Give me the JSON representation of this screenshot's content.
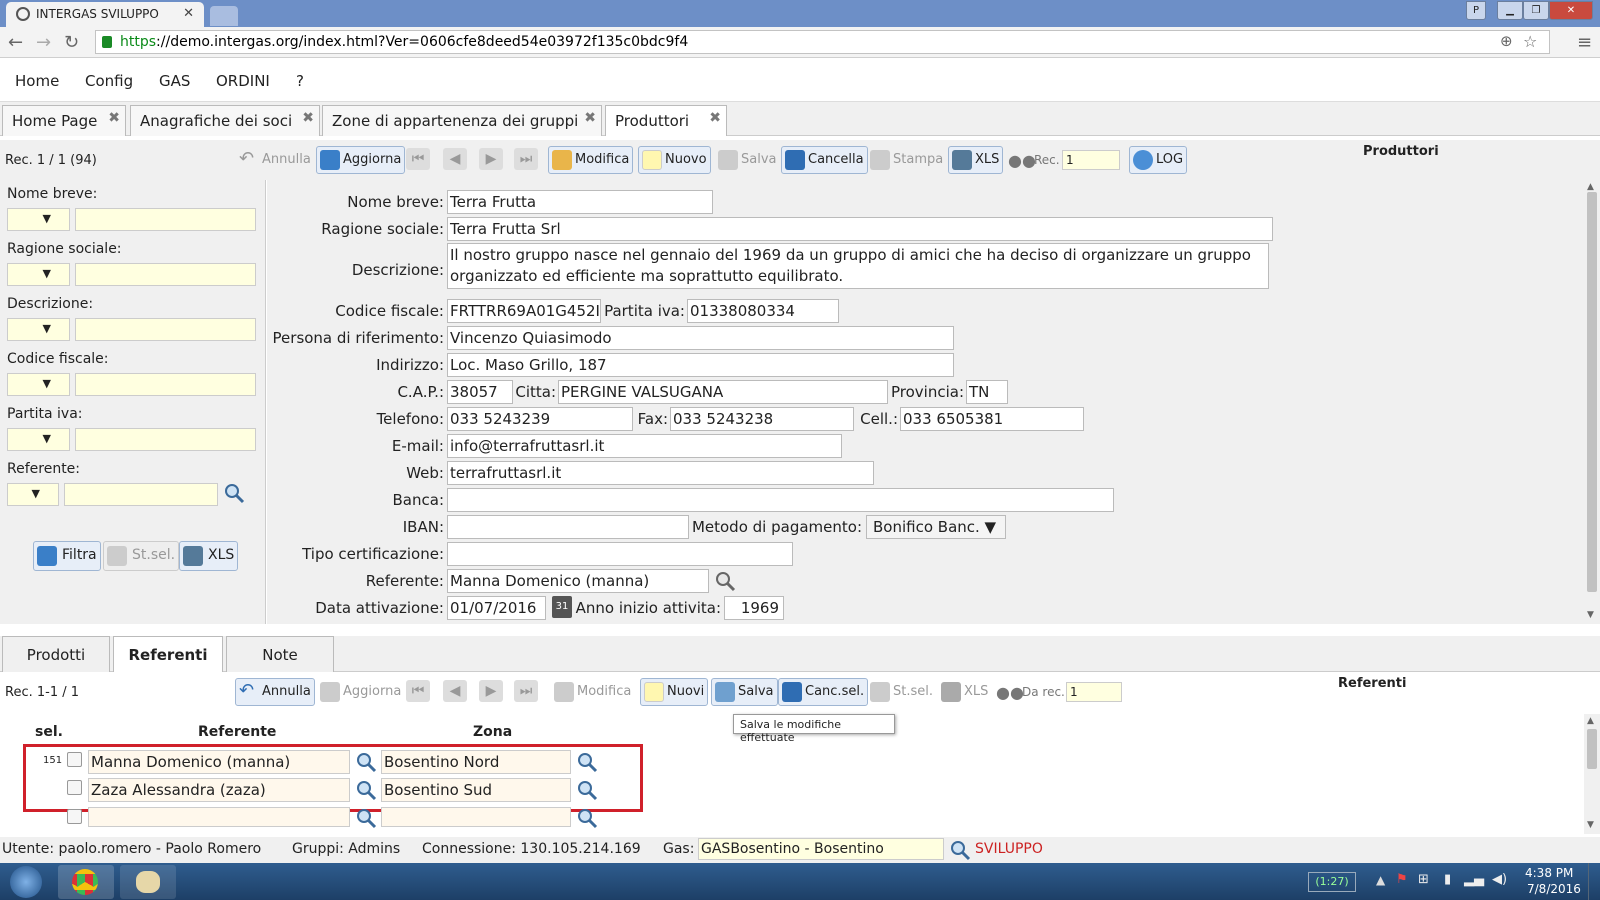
{
  "browser": {
    "tab_title": "INTERGAS SVILUPPO",
    "url_scheme": "https",
    "url_rest": "://demo.intergas.org/index.html?Ver=0606cfe8deed54e03972f135c0bdc9f4"
  },
  "menu": [
    "Home",
    "Config",
    "GAS",
    "ORDINI",
    "?"
  ],
  "page_tabs": [
    "Home Page",
    "Anagrafiche dei soci",
    "Zone di appartenenza dei gruppi",
    "Produttori"
  ],
  "main_toolbar": {
    "rec_info": "Rec. 1 / 1 (94)",
    "annulla": "Annulla",
    "aggiorna": "Aggiorna",
    "modifica": "Modifica",
    "nuovo": "Nuovo",
    "salva": "Salva",
    "cancella": "Cancella",
    "stampa": "Stampa",
    "xls": "XLS",
    "rec_label": "Rec.",
    "rec_value": "1",
    "log": "LOG",
    "section_title": "Produttori"
  },
  "filters": {
    "labels": [
      "Nome breve:",
      "Ragione sociale:",
      "Descrizione:",
      "Codice fiscale:",
      "Partita iva:",
      "Referente:"
    ],
    "select_arrow": "▼",
    "filtra": "Filtra",
    "st_sel": "St.sel.",
    "xls": "XLS"
  },
  "form": {
    "nome_breve_label": "Nome breve:",
    "nome_breve": "Terra Frutta",
    "ragione_sociale_label": "Ragione sociale:",
    "ragione_sociale": "Terra Frutta Srl",
    "descrizione_label": "Descrizione:",
    "descrizione": "Il nostro gruppo nasce nel gennaio del 1969 da un gruppo di amici che ha deciso di organizzare un gruppo organizzato ed efficiente ma soprattutto equilibrato.",
    "codice_fiscale_label": "Codice fiscale:",
    "codice_fiscale": "FRTTRR69A01G452I",
    "partita_iva_label": "Partita iva:",
    "partita_iva": "01338080334",
    "persona_label": "Persona di riferimento:",
    "persona": "Vincenzo Quiasimodo",
    "indirizzo_label": "Indirizzo:",
    "indirizzo": "Loc. Maso Grillo, 187",
    "cap_label": "C.A.P.:",
    "cap": "38057",
    "citta_label": "Citta:",
    "citta": "PERGINE VALSUGANA",
    "provincia_label": "Provincia:",
    "provincia": "TN",
    "telefono_label": "Telefono:",
    "telefono": "033 5243239",
    "fax_label": "Fax:",
    "fax": "033 5243238",
    "cell_label": "Cell.:",
    "cell": "033 6505381",
    "email_label": "E-mail:",
    "email": "info@terrafruttasrl.it",
    "web_label": "Web:",
    "web": "terrafruttasrl.it",
    "banca_label": "Banca:",
    "banca": "",
    "iban_label": "IBAN:",
    "iban": "",
    "metodo_label": "Metodo di pagamento:",
    "metodo": "Bonifico Banc. ▼",
    "tipo_cert_label": "Tipo certificazione:",
    "tipo_cert": "",
    "referente_label": "Referente:",
    "referente": "Manna Domenico (manna)",
    "data_att_label": "Data attivazione:",
    "data_att": "01/07/2016",
    "cal_day": "31",
    "anno_label": "Anno inizio attivita:",
    "anno": "1969"
  },
  "subtabs": [
    "Prodotti",
    "Referenti",
    "Note"
  ],
  "sub_toolbar": {
    "rec_info": "Rec. 1-1 / 1",
    "annulla": "Annulla",
    "aggiorna": "Aggiorna",
    "modifica": "Modifica",
    "nuovi": "Nuovi",
    "salva": "Salva",
    "canc_sel": "Canc.sel.",
    "st_sel": "St.sel.",
    "xls": "XLS",
    "da_rec": "Da rec.",
    "da_rec_value": "1",
    "section_title": "Referenti",
    "tooltip": "Salva le modifiche effettuate"
  },
  "grid": {
    "headers": [
      "sel.",
      "Referente",
      "Zona"
    ],
    "rows": [
      {
        "id": "151",
        "referente": "Manna Domenico (manna)",
        "zona": "Bosentino Nord"
      },
      {
        "id": "",
        "referente": "Zaza Alessandra (zaza)",
        "zona": "Bosentino Sud"
      },
      {
        "id": "",
        "referente": "",
        "zona": ""
      }
    ]
  },
  "status": {
    "utente": "Utente: paolo.romero - Paolo Romero",
    "gruppi": "Gruppi: Admins",
    "connessione": "Connessione: 130.105.214.169",
    "gas_label": "Gas:",
    "gas_value": "GASBosentino - Bosentino",
    "env": "SVILUPPO"
  },
  "taskbar": {
    "battery": "(1:27)",
    "time": "4:38 PM",
    "date": "7/8/2016"
  },
  "colors": {
    "accent_border": "#9fb6d3",
    "filter_yellow": "#ffffe0",
    "highlight_red": "#d0202a",
    "env_red": "#cc2222"
  }
}
